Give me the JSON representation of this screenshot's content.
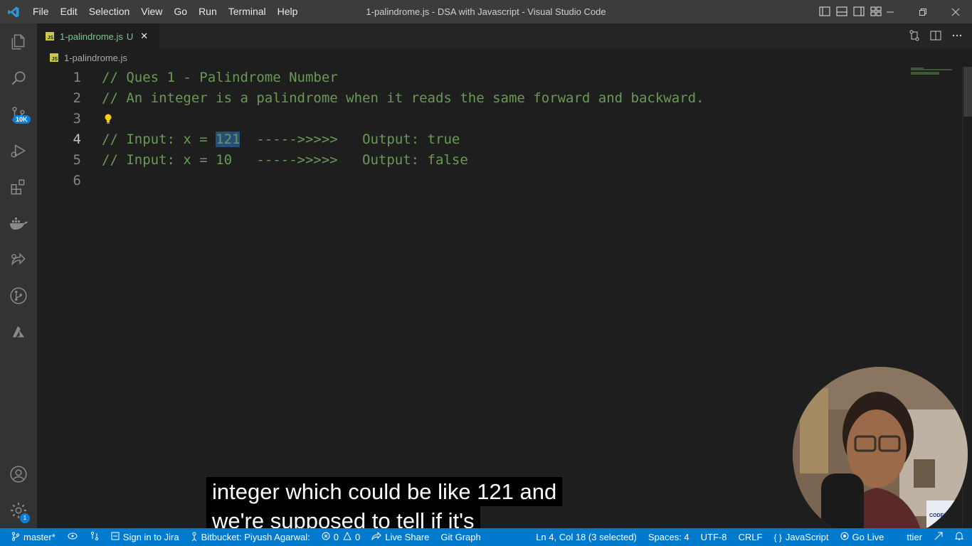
{
  "titlebar": {
    "menu": [
      "File",
      "Edit",
      "Selection",
      "View",
      "Go",
      "Run",
      "Terminal",
      "Help"
    ],
    "title": "1-palindrome.js - DSA with Javascript - Visual Studio Code"
  },
  "activity_bar": {
    "items": [
      "explorer-icon",
      "search-icon",
      "source-control-icon",
      "run-debug-icon",
      "extensions-icon",
      "docker-icon",
      "live-share-icon",
      "git-graph-icon",
      "azure-icon"
    ],
    "source_control_badge": "10K",
    "bottom_items": [
      "account-icon",
      "manage-gear-icon"
    ],
    "manage_badge": "1"
  },
  "tab": {
    "name": "1-palindrome.js",
    "status": "U",
    "close": "✕",
    "icon_text": "JS"
  },
  "breadcrumb": {
    "file": "1-palindrome.js"
  },
  "editor": {
    "lines": [
      {
        "num": "1",
        "pre": "// Ques 1 - Palindrome Number",
        "sel": "",
        "post": ""
      },
      {
        "num": "2",
        "pre": "// An integer is a palindrome when it reads the same forward and backward.",
        "sel": "",
        "post": ""
      },
      {
        "num": "3",
        "pre": "",
        "sel": "",
        "post": ""
      },
      {
        "num": "4",
        "pre": "// Input: x = ",
        "sel": "121",
        "post": "  ----->>>>>   Output: true"
      },
      {
        "num": "5",
        "pre": "// Input: x = 10   ----->>>>>   Output: false",
        "sel": "",
        "post": ""
      },
      {
        "num": "6",
        "pre": "",
        "sel": "",
        "post": ""
      }
    ],
    "active_line": 4
  },
  "status_bar": {
    "branch": "master*",
    "jira": "Sign in to Jira",
    "bitbucket": "Bitbucket: Piyush Agarwal:",
    "errors": "0",
    "warnings": "0",
    "live_share": "Live Share",
    "git_graph": "Git Graph",
    "position": "Ln 4, Col 18 (3 selected)",
    "spaces": "Spaces: 4",
    "encoding": "UTF-8",
    "eol": "CRLF",
    "language": "JavaScript",
    "go_live": "Go Live",
    "prettier": "ttier"
  },
  "captions": {
    "line1": "integer which could be like 121 and",
    "line2": "we're supposed to tell if it's"
  },
  "webcam": {
    "logo_text": "CODER"
  },
  "colors": {
    "accent": "#007acc",
    "comment": "#6a9955",
    "selection": "#264f78",
    "untracked": "#73c991"
  }
}
